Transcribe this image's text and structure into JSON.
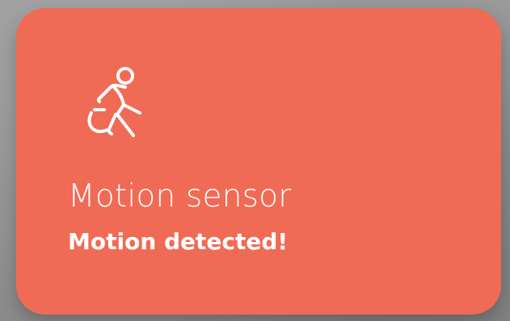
{
  "widget": {
    "icon": "running-person-icon",
    "title": "Motion sensor",
    "status": "Motion detected!",
    "accent_color": "#F06B55",
    "text_color": "#FFFFFF"
  }
}
